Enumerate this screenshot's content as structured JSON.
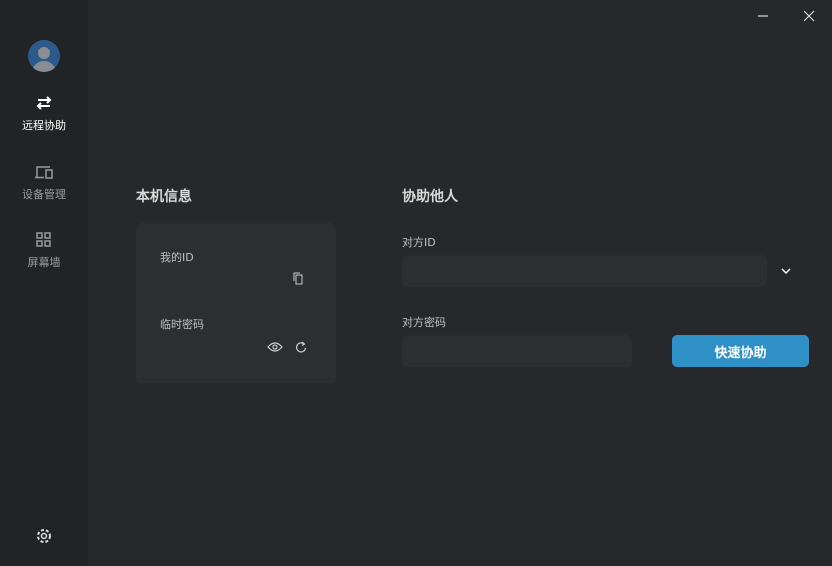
{
  "sidebar": {
    "items": [
      {
        "label": "远程协助",
        "icon": "swap-arrows-icon",
        "active": true
      },
      {
        "label": "设备管理",
        "icon": "devices-icon"
      },
      {
        "label": "屏幕墙",
        "icon": "grid-icon"
      }
    ],
    "settings_icon": "gear-icon"
  },
  "local": {
    "title": "本机信息",
    "my_id_label": "我的ID",
    "temp_password_label": "临时密码"
  },
  "remote": {
    "title": "协助他人",
    "peer_id_label": "对方ID",
    "peer_id_value": "",
    "peer_password_label": "对方密码",
    "peer_password_value": "",
    "connect_button": "快速协助"
  },
  "colors": {
    "accent": "#2f90c8"
  }
}
